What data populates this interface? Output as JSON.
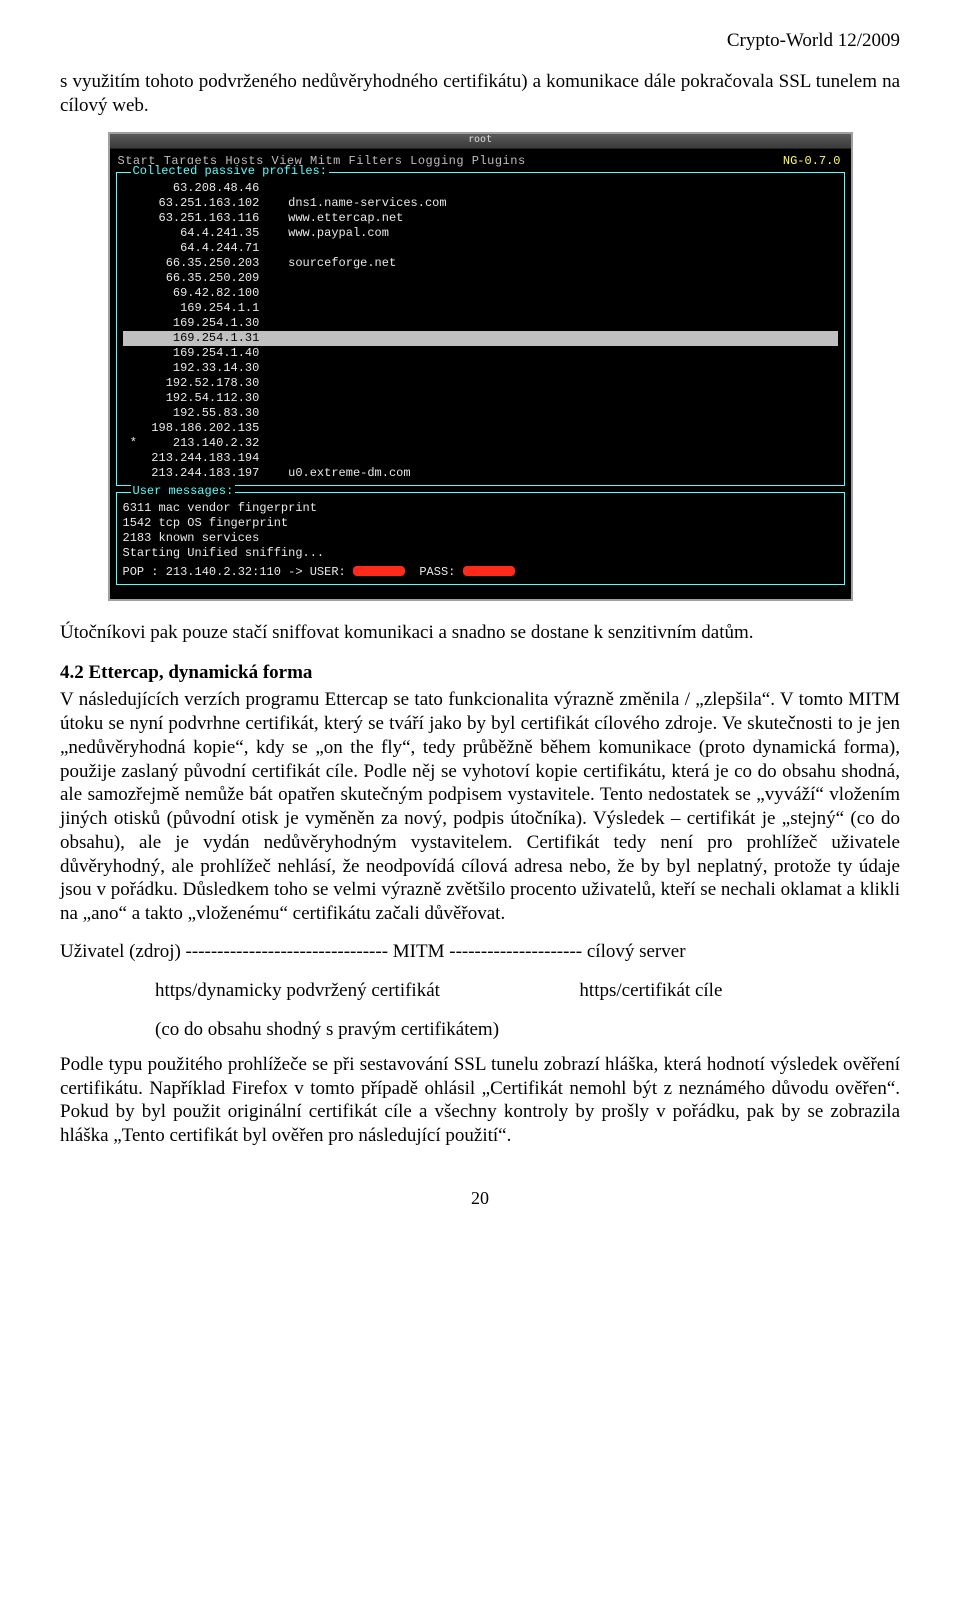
{
  "header": {
    "issue": "Crypto-World 12/2009"
  },
  "intro": "s využitím tohoto podvrženého nedůvěryhodného certifikátu) a komunikace dále pokračovala SSL tunelem na cílový web.",
  "screenshot": {
    "titlebar": "root",
    "menu": "Start  Targets  Hosts  View  Mitm  Filters  Logging  Plugins",
    "version": "NG-0.7.0",
    "frame_title": "Collected passive profiles:",
    "rows": [
      {
        "ip": "63.208.48.46",
        "host": ""
      },
      {
        "ip": "63.251.163.102",
        "host": "dns1.name-services.com"
      },
      {
        "ip": "63.251.163.116",
        "host": "www.ettercap.net"
      },
      {
        "ip": "64.4.241.35",
        "host": "www.paypal.com"
      },
      {
        "ip": "64.4.244.71",
        "host": ""
      },
      {
        "ip": "66.35.250.203",
        "host": "sourceforge.net"
      },
      {
        "ip": "66.35.250.209",
        "host": ""
      },
      {
        "ip": "69.42.82.100",
        "host": ""
      },
      {
        "ip": "169.254.1.1",
        "host": ""
      },
      {
        "ip": "169.254.1.30",
        "host": ""
      },
      {
        "ip": "169.254.1.31",
        "host": "",
        "selected": true
      },
      {
        "ip": "169.254.1.40",
        "host": ""
      },
      {
        "ip": "192.33.14.30",
        "host": ""
      },
      {
        "ip": "192.52.178.30",
        "host": ""
      },
      {
        "ip": "192.54.112.30",
        "host": ""
      },
      {
        "ip": "192.55.83.30",
        "host": ""
      },
      {
        "ip": "198.186.202.135",
        "host": ""
      },
      {
        "ip": "213.140.2.32",
        "host": "",
        "star": true
      },
      {
        "ip": "213.244.183.194",
        "host": ""
      },
      {
        "ip": "213.244.183.197",
        "host": "u0.extreme-dm.com"
      }
    ],
    "msg_title": "User messages:",
    "msgs": [
      "6311 mac vendor fingerprint",
      "1542 tcp OS fingerprint",
      "2183 known services",
      "Starting Unified sniffing..."
    ],
    "pop_line_prefix": "POP : 213.140.2.32:110 -> USER: ",
    "pop_pass_label": "  PASS: "
  },
  "after_shot": "Útočníkovi pak pouze stačí sniffovat komunikaci a snadno se dostane k senzitivním datům.",
  "section": {
    "heading": "4.2 Ettercap, dynamická forma",
    "body": "V následujících verzích programu Ettercap se tato funkcionalita výrazně změnila / „zlepšila“. V tomto MITM útoku se nyní podvrhne certifikát, který se tváří jako by byl certifikát cílového zdroje. Ve skutečnosti to je jen „nedůvěryhodná kopie“, kdy se „on the fly“, tedy průběžně během komunikace (proto dynamická forma), použije zaslaný původní certifikát cíle. Podle něj se vyhotoví kopie certifikátu, která je co do obsahu shodná, ale samozřejmě nemůže bát opatřen skutečným podpisem vystavitele. Tento nedostatek se „vyváží“ vložením jiných otisků (původní otisk je vyměněn za nový, podpis útočníka). Výsledek – certifikát je „stejný“ (co do obsahu), ale je vydán nedůvěryhodným vystavitelem. Certifikát tedy není pro prohlížeč uživatele důvěryhodný, ale prohlížeč nehlásí, že neodpovídá cílová adresa nebo, že by byl neplatný, protože ty údaje jsou v pořádku. Důsledkem toho se velmi výrazně zvětšilo procento uživatelů, kteří se nechali oklamat a klikli na „ano“ a takto „vloženému“ certifikátu začali důvěřovat."
  },
  "diagram": {
    "line1": "Uživatel (zdroj)  -------------------------------- MITM --------------------- cílový server",
    "left_label": "https/dynamicky podvržený certifikát",
    "right_label": "https/certifikát cíle",
    "line3": "(co do obsahu shodný s pravým certifikátem)"
  },
  "closing": "Podle typu použitého prohlížeče se při sestavování SSL tunelu zobrazí hláška, která hodnotí výsledek ověření certifikátu. Například Firefox v tomto případě ohlásil „Certifikát nemohl být z neznámého důvodu ověřen“. Pokud by byl použit originální certifikát cíle a všechny kontroly by prošly v pořádku, pak by se zobrazila hláška „Tento certifikát byl ověřen pro následující použití“.",
  "page_number": "20"
}
